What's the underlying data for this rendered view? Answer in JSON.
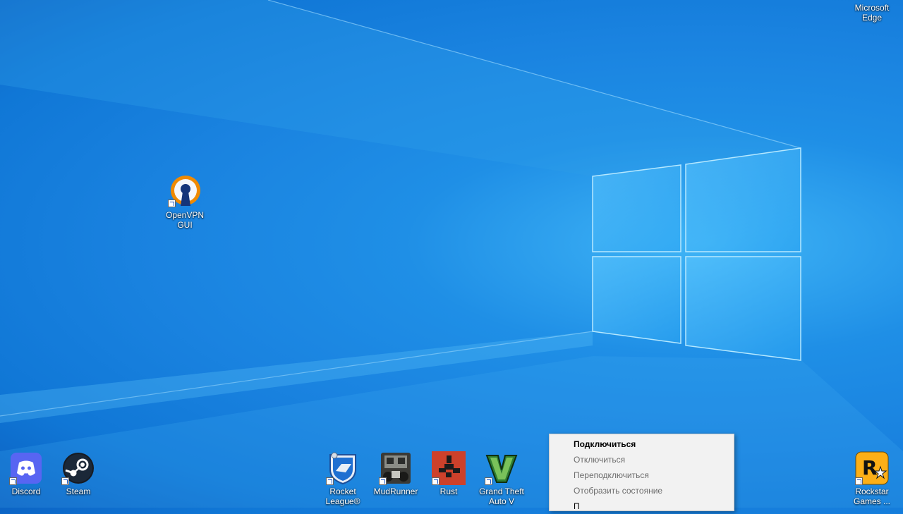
{
  "desktop": {
    "icons": [
      {
        "label": "Microsoft Edge",
        "icon": "edge-icon"
      },
      {
        "label": "OpenVPN GUI",
        "icon": "openvpn-icon"
      },
      {
        "label": "Discord",
        "icon": "discord-icon"
      },
      {
        "label": "Steam",
        "icon": "steam-icon"
      },
      {
        "label": "Rocket League®",
        "icon": "rocket-league-icon"
      },
      {
        "label": "MudRunner",
        "icon": "mudrunner-icon"
      },
      {
        "label": "Rust",
        "icon": "rust-icon"
      },
      {
        "label": "Grand Theft Auto V",
        "icon": "gta-v-icon"
      },
      {
        "label": "Rockstar Games ...",
        "icon": "rockstar-games-icon"
      }
    ]
  },
  "context_menu": {
    "items": [
      {
        "label": "Подключиться",
        "bold": true
      },
      {
        "label": "Отключиться"
      },
      {
        "label": "Переподключиться"
      },
      {
        "label": "Отобразить состояние"
      },
      {
        "label": "П"
      }
    ]
  },
  "colors": {
    "accent": "#1a83e0",
    "openvpn_orange": "#f08a00",
    "discord": "#5865f2",
    "rust_red": "#cd412b",
    "rockstar_yellow": "#fcaf17"
  }
}
